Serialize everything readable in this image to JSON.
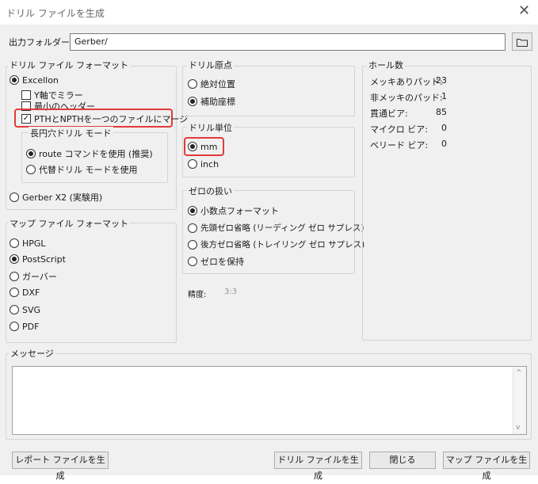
{
  "window": {
    "title": "ドリル ファイルを生成"
  },
  "output_folder": {
    "label": "出力フォルダー:",
    "value": "Gerber/"
  },
  "drill_format": {
    "title": "ドリル ファイル フォーマット",
    "excellon": "Excellon",
    "mirror_y": "Y軸でミラー",
    "min_header": "最小のヘッダー",
    "merge_pth": "PTHとNPTHを一つのファイルにマージ",
    "oval_title": "長円穴ドリル モード",
    "route": "route コマンドを使用 (推奨)",
    "alt_drill": "代替ドリル モードを使用",
    "gerber_x2": "Gerber X2 (実験用)"
  },
  "map_format": {
    "title": "マップ ファイル フォーマット",
    "options": [
      "HPGL",
      "PostScript",
      "ガーバー",
      "DXF",
      "SVG",
      "PDF"
    ]
  },
  "origin": {
    "title": "ドリル原点",
    "absolute": "絶対位置",
    "aux": "補助座標"
  },
  "units": {
    "title": "ドリル単位",
    "mm": "mm",
    "inch": "inch"
  },
  "zeros": {
    "title": "ゼロの扱い",
    "decimal": "小数点フォーマット",
    "leading": "先頭ゼロ省略 (リーディング ゼロ サプレス)",
    "trailing": "後方ゼロ省略 (トレイリング ゼロ サプレス)",
    "keep": "ゼロを保持"
  },
  "precision": {
    "label": "精度:",
    "value": "3:3"
  },
  "hole_count": {
    "title": "ホール数",
    "rows": [
      {
        "label": "メッキありパッド:",
        "value": "23"
      },
      {
        "label": "非メッキのパッド:",
        "value": "1"
      },
      {
        "label": "貫通ビア:",
        "value": "85"
      },
      {
        "label": "マイクロ ビア:",
        "value": "0"
      },
      {
        "label": "ベリード ビア:",
        "value": "0"
      }
    ]
  },
  "messages": {
    "title": "メッセージ"
  },
  "buttons": {
    "report": "レポート ファイルを生成",
    "drill": "ドリル ファイルを生成",
    "close": "閉じる",
    "map": "マップ ファイルを生成"
  }
}
